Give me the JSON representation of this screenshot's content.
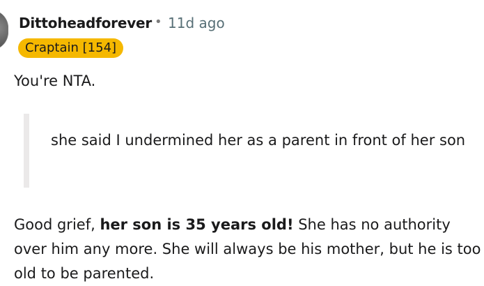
{
  "comment": {
    "author": "Dittoheadforever",
    "separator": "•",
    "time_ago": "11d ago",
    "flair": "Craptain [154]",
    "paragraph_1": "You're NTA.",
    "quote": "she said I undermined her as a parent in front of her son",
    "paragraph_2": {
      "intro": "Good grief, ",
      "bold": "her son is 35 years old!",
      "rest": " She has no authority over him any more. She will always be his mother, but he is too old to be parented."
    }
  }
}
